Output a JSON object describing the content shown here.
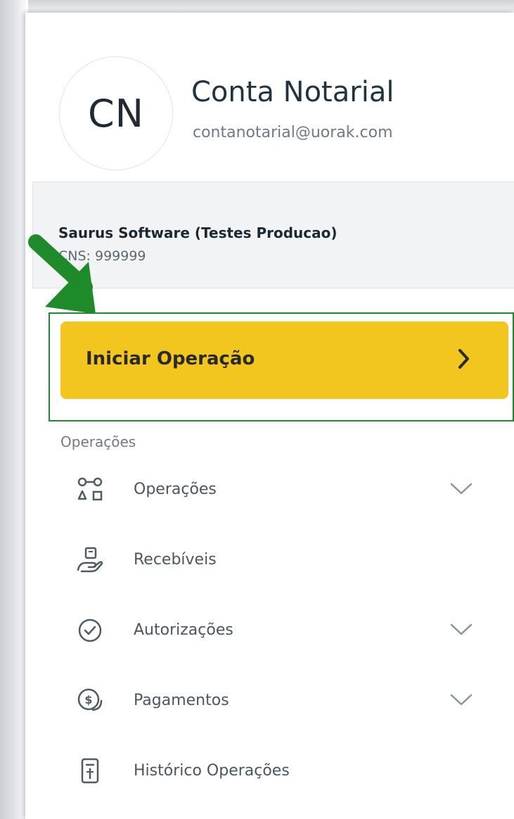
{
  "profile": {
    "initials": "CN",
    "name": "Conta Notarial",
    "email": "contanotarial@uorak.com"
  },
  "organization": {
    "name": "Saurus Software (Testes Producao)",
    "cns": "CNS: 999999"
  },
  "start_button": {
    "label": "Iniciar Operação",
    "icon": "chevron-right-icon"
  },
  "menu": {
    "section_title": "Operações",
    "items": [
      {
        "label": "Operações",
        "icon": "operations-icon",
        "expandable": true
      },
      {
        "label": "Recebíveis",
        "icon": "hand-money-icon",
        "expandable": false
      },
      {
        "label": "Autorizações",
        "icon": "check-circle-icon",
        "expandable": true
      },
      {
        "label": "Pagamentos",
        "icon": "coin-icon",
        "expandable": true
      },
      {
        "label": "Histórico Operações",
        "icon": "document-list-icon",
        "expandable": false
      }
    ]
  },
  "colors": {
    "accent": "#f2c61f",
    "highlight": "#1e8b2c",
    "icon": "#4d5b66"
  }
}
